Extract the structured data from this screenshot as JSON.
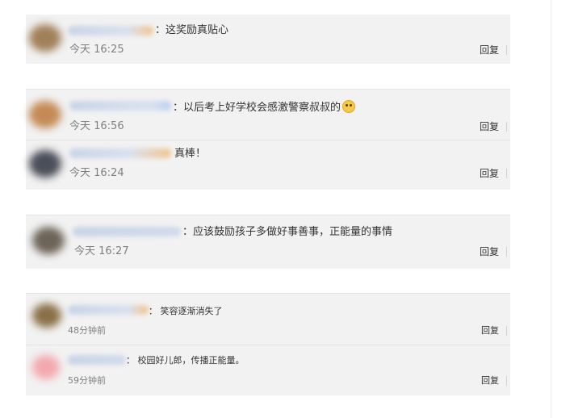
{
  "groups": [
    {
      "comments": [
        {
          "text": "：这奖励真贴心",
          "time": "今天 16:25",
          "reply": "回复"
        }
      ]
    },
    {
      "comments": [
        {
          "text": "：以后考上好学校会感激警察叔叔的",
          "time": "今天 16:56",
          "reply": "回复",
          "emoji": "grinning-emoji"
        },
        {
          "text": "真棒！",
          "time": "今天 16:24",
          "reply": "回复"
        }
      ]
    },
    {
      "comments": [
        {
          "text": "：应该鼓励孩子多做好事善事，正能量的事情",
          "time": "今天 16:27",
          "reply": "回复"
        }
      ]
    },
    {
      "comments": [
        {
          "text": "：  笑容逐渐消失了",
          "time": "48分钟前",
          "reply": "回复"
        },
        {
          "text": "：  校园好儿郎，传播正能量。",
          "time": "59分钟前",
          "reply": "回复"
        }
      ]
    }
  ],
  "colors": {
    "card_bg": "#f2f2f2",
    "time_gray": "#808080",
    "text": "#333333"
  }
}
